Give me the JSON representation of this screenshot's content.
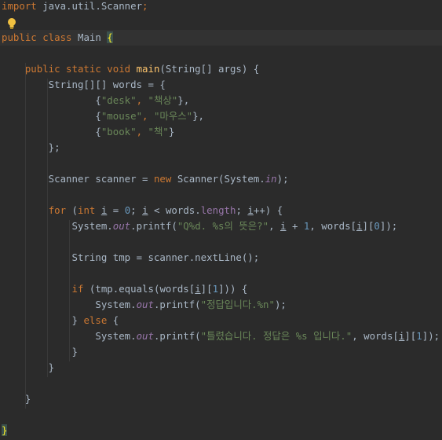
{
  "editor": {
    "lines": [
      [
        {
          "t": "import ",
          "c": "kw"
        },
        {
          "t": "java.util.Scanner",
          "c": ""
        },
        {
          "t": ";",
          "c": "kw"
        }
      ],
      [],
      [
        {
          "t": "public class ",
          "c": "kw"
        },
        {
          "t": "Main ",
          "c": ""
        },
        {
          "t": "{",
          "c": "brace-hl"
        }
      ],
      [],
      [
        {
          "t": "    public static void ",
          "c": "kw"
        },
        {
          "t": "main",
          "c": "fn"
        },
        {
          "t": "(String[] args) {",
          "c": ""
        }
      ],
      [
        {
          "t": "        String[][] words = {",
          "c": ""
        }
      ],
      [
        {
          "t": "                {",
          "c": ""
        },
        {
          "t": "\"desk\"",
          "c": "str"
        },
        {
          "t": ", ",
          "c": "kw"
        },
        {
          "t": "\"책상\"",
          "c": "str"
        },
        {
          "t": "},",
          "c": ""
        }
      ],
      [
        {
          "t": "                {",
          "c": ""
        },
        {
          "t": "\"mouse\"",
          "c": "str"
        },
        {
          "t": ", ",
          "c": "kw"
        },
        {
          "t": "\"마우스\"",
          "c": "str"
        },
        {
          "t": "},",
          "c": ""
        }
      ],
      [
        {
          "t": "                {",
          "c": ""
        },
        {
          "t": "\"book\"",
          "c": "str"
        },
        {
          "t": ", ",
          "c": "kw"
        },
        {
          "t": "\"책\"",
          "c": "str"
        },
        {
          "t": "}",
          "c": ""
        }
      ],
      [
        {
          "t": "        };",
          "c": ""
        }
      ],
      [],
      [
        {
          "t": "        Scanner scanner = ",
          "c": ""
        },
        {
          "t": "new ",
          "c": "kw"
        },
        {
          "t": "Scanner(System.",
          "c": ""
        },
        {
          "t": "in",
          "c": "field"
        },
        {
          "t": ");",
          "c": ""
        }
      ],
      [],
      [
        {
          "t": "        ",
          "c": ""
        },
        {
          "t": "for ",
          "c": "kw"
        },
        {
          "t": "(",
          "c": ""
        },
        {
          "t": "int ",
          "c": "kw"
        },
        {
          "t": "i",
          "c": "var"
        },
        {
          "t": " = ",
          "c": ""
        },
        {
          "t": "0",
          "c": "num"
        },
        {
          "t": "; ",
          "c": ""
        },
        {
          "t": "i",
          "c": "var"
        },
        {
          "t": " < words.",
          "c": ""
        },
        {
          "t": "length",
          "c": "prop"
        },
        {
          "t": "; ",
          "c": ""
        },
        {
          "t": "i",
          "c": "var"
        },
        {
          "t": "++) {",
          "c": ""
        }
      ],
      [
        {
          "t": "            System.",
          "c": ""
        },
        {
          "t": "out",
          "c": "field"
        },
        {
          "t": ".printf(",
          "c": ""
        },
        {
          "t": "\"Q%d. %s의 뜻은?\"",
          "c": "str"
        },
        {
          "t": ", ",
          "c": ""
        },
        {
          "t": "i",
          "c": "var"
        },
        {
          "t": " + ",
          "c": ""
        },
        {
          "t": "1",
          "c": "num"
        },
        {
          "t": ", words[",
          "c": ""
        },
        {
          "t": "i",
          "c": "var"
        },
        {
          "t": "][",
          "c": ""
        },
        {
          "t": "0",
          "c": "num"
        },
        {
          "t": "]);",
          "c": ""
        }
      ],
      [],
      [
        {
          "t": "            String tmp = scanner.nextLine();",
          "c": ""
        }
      ],
      [],
      [
        {
          "t": "            ",
          "c": ""
        },
        {
          "t": "if ",
          "c": "kw"
        },
        {
          "t": "(tmp.equals(words[",
          "c": ""
        },
        {
          "t": "i",
          "c": "var"
        },
        {
          "t": "][",
          "c": ""
        },
        {
          "t": "1",
          "c": "num"
        },
        {
          "t": "])) {",
          "c": ""
        }
      ],
      [
        {
          "t": "                System.",
          "c": ""
        },
        {
          "t": "out",
          "c": "field"
        },
        {
          "t": ".printf(",
          "c": ""
        },
        {
          "t": "\"정답입니다.%n\"",
          "c": "str"
        },
        {
          "t": ");",
          "c": ""
        }
      ],
      [
        {
          "t": "            } ",
          "c": ""
        },
        {
          "t": "else ",
          "c": "kw"
        },
        {
          "t": "{",
          "c": ""
        }
      ],
      [
        {
          "t": "                System.",
          "c": ""
        },
        {
          "t": "out",
          "c": "field"
        },
        {
          "t": ".printf(",
          "c": ""
        },
        {
          "t": "\"틀렸습니다. 정답은 %s 입니다.\"",
          "c": "str"
        },
        {
          "t": ", words[",
          "c": ""
        },
        {
          "t": "i",
          "c": "var"
        },
        {
          "t": "][",
          "c": ""
        },
        {
          "t": "1",
          "c": "num"
        },
        {
          "t": "]);",
          "c": ""
        }
      ],
      [
        {
          "t": "            }",
          "c": ""
        }
      ],
      [
        {
          "t": "        }",
          "c": ""
        }
      ],
      [],
      [
        {
          "t": "    }",
          "c": ""
        }
      ],
      [],
      [
        {
          "t": "}",
          "c": "brace-hl"
        }
      ]
    ]
  },
  "icons": {
    "intention": "lightbulb-icon"
  },
  "colors": {
    "background": "#2b2b2b",
    "keyword": "#cc7832",
    "string": "#6a8759",
    "number": "#6897bb",
    "field": "#9876aa",
    "method": "#ffc66d",
    "text": "#a9b7c6"
  }
}
